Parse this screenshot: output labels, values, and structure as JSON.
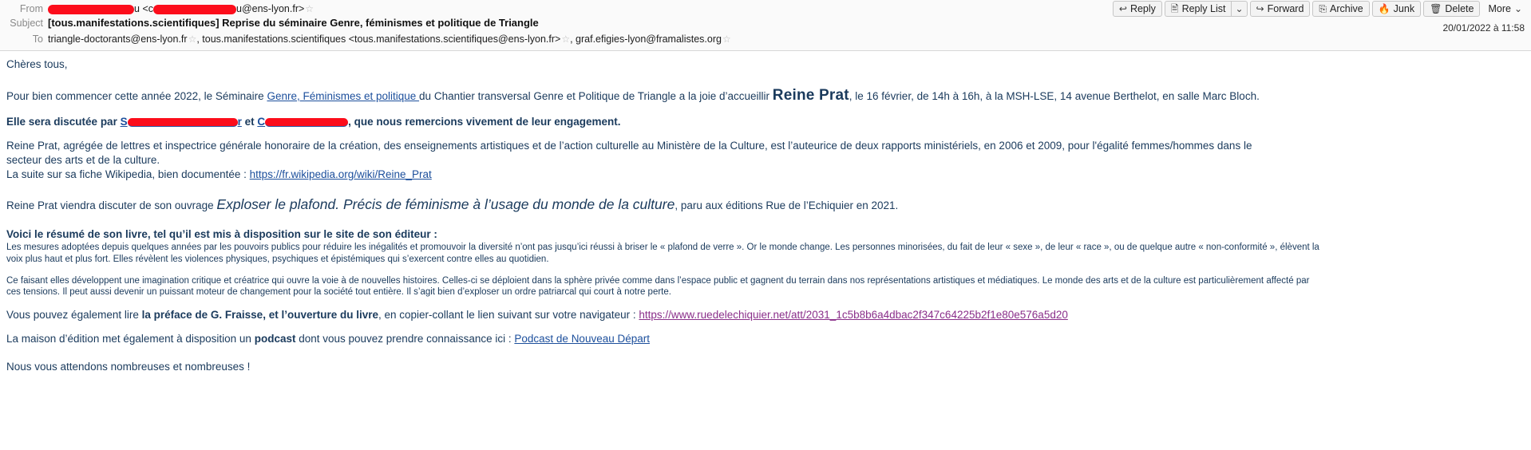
{
  "toolbar": {
    "reply": {
      "label": "Reply",
      "icon": "reply-arrow-icon"
    },
    "reply_list": {
      "label": "Reply List",
      "icon": "reply-list-icon"
    },
    "reply_list_dropdown": "⌄",
    "forward": {
      "label": "Forward",
      "icon": "forward-arrow-icon"
    },
    "archive": {
      "label": "Archive",
      "icon": "archive-box-icon"
    },
    "junk": {
      "label": "Junk",
      "icon": "junk-flame-icon"
    },
    "delete": {
      "label": "Delete",
      "icon": "trash-can-icon"
    },
    "more": {
      "label": "More",
      "icon": "chevron-down-icon"
    }
  },
  "header": {
    "from_label": "From",
    "from_name_suffix": "u",
    "from_email_prefix": "<c",
    "from_email_suffix": "u@ens-lyon.fr>",
    "subject_label": "Subject",
    "subject": "[tous.manifestations.scientifiques] Reprise du séminaire Genre, féminismes et politique de Triangle",
    "date": "20/01/2022 à 11:58",
    "to_label": "To",
    "to_1": "triangle-doctorants@ens-lyon.fr",
    "to_2": "tous.manifestations.scientifiques <tous.manifestations.scientifiques@ens-lyon.fr>",
    "to_3": "graf.efigies-lyon@framalistes.org",
    "star_glyph": "☆"
  },
  "body": {
    "greeting": "Chères tous,",
    "p1_a": "Pour bien commencer cette année 2022, le Séminaire ",
    "p1_link": "Genre, Féminismes et politique ",
    "p1_b": " du Chantier transversal Genre et Politique de Triangle a la joie d’accueillir ",
    "p1_name": "Reine Prat",
    "p1_c": ", le 16 février, de 14h à 16h, à la MSH-LSE, 14 avenue Berthelot, en salle Marc Bloch.",
    "p2_a": "Elle sera discutée par ",
    "p2_s": "S",
    "p2_mid1": "r",
    "p2_et": " et ",
    "p2_c": "C",
    "p2_mid2": "",
    "p2_b": ", que nous remercions vivement de leur engagement.",
    "p3_line1": "Reine Prat, agrégée de lettres et inspectrice générale honoraire de la création, des enseignements artistiques et de l’action culturelle au Ministère de la Culture, est l’auteurice de deux rapports ministériels, en 2006 et 2009, pour l'égalité femmes/hommes dans le",
    "p3_line2": "secteur des arts et de la culture.",
    "p4_a": "La suite sur sa fiche Wikipedia, bien documentée : ",
    "p4_link": "https://fr.wikipedia.org/wiki/Reine_Prat",
    "p5_a": "Reine Prat viendra discuter de son ouvrage ",
    "p5_title": "Exploser le plafond. Précis de féminisme à l’usage du monde de la culture",
    "p5_b": ", paru aux éditions Rue de l’Echiquier en 2021.",
    "p6_heading": "Voici le résumé de son livre, tel qu’il est mis à disposition sur le site de son éditeur :",
    "p6_s1_line1": "Les mesures adoptées depuis quelques années par les pouvoirs publics pour réduire les inégalités et promouvoir la diversité n’ont pas jusqu’ici réussi à briser le « plafond de verre ». Or le monde change. Les personnes minorisées, du fait de leur « sexe », de leur « race », ou de quelque autre « non-conformité », élèvent la",
    "p6_s1_line2": "voix plus haut et plus fort. Elles révèlent les violences physiques, psychiques et épistémiques qui s’exercent contre elles au quotidien.",
    "p6_s2_line1": "Ce faisant elles développent une imagination critique et créatrice qui ouvre la voie à de nouvelles histoires. Celles-ci se déploient dans la sphère privée comme dans l’espace public et gagnent du terrain dans nos représentations artistiques et médiatiques. Le monde des arts et de la culture est particulièrement affecté par",
    "p6_s2_line2": "ces tensions. Il peut aussi devenir un puissant moteur de changement pour la société tout entière. Il s’agit bien d’exploser un ordre patriarcal qui court à notre perte.",
    "p7_a": "Vous pouvez également lire ",
    "p7_bold": "la préface de G. Fraisse, et l’ouverture du livre",
    "p7_b": ", en copier-collant le lien suivant sur votre navigateur : ",
    "p7_link": "https://www.ruedelechiquier.net/att/2031_1c5b8b6a4dbac2f347c64225b2f1e80e576a5d20",
    "p8_a": "La maison d’édition met également à disposition un ",
    "p8_bold": "podcast",
    "p8_b": " dont vous pouvez prendre connaissance ici : ",
    "p8_link": "Podcast de Nouveau Départ",
    "p9": "Nous vous attendons nombreuses et nombreuses !"
  },
  "colors": {
    "body_text": "#1a3a5c",
    "link": "#1c4f9c",
    "link_visited": "#8a2f8a",
    "redaction": "#fc0d1b",
    "header_bg": "#fafafa"
  }
}
